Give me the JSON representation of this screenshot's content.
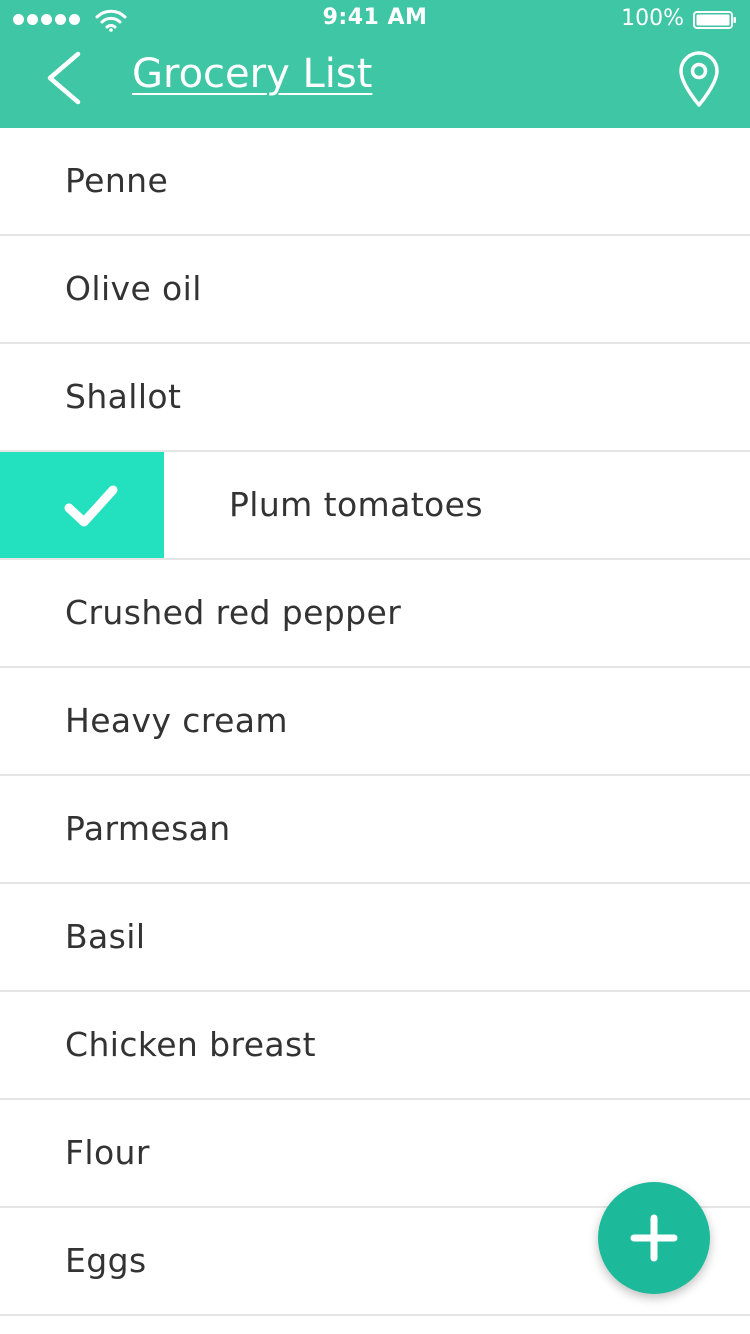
{
  "status_bar": {
    "time": "9:41 AM",
    "battery_percent": "100%",
    "signal_bars": 5,
    "icons": [
      "signal-dots-icon",
      "wifi-icon",
      "battery-icon"
    ]
  },
  "header": {
    "title": "Grocery List",
    "back_icon": "chevron-left-icon",
    "location_icon": "map-pin-icon",
    "background_color": "#3fc6a5"
  },
  "items": [
    {
      "label": "Penne",
      "swiped": false
    },
    {
      "label": "Olive oil",
      "swiped": false
    },
    {
      "label": "Shallot",
      "swiped": false
    },
    {
      "label": "Plum tomatoes",
      "swiped": true
    },
    {
      "label": "Crushed red pepper",
      "swiped": false
    },
    {
      "label": "Heavy cream",
      "swiped": false
    },
    {
      "label": "Parmesan",
      "swiped": false
    },
    {
      "label": "Basil",
      "swiped": false
    },
    {
      "label": "Chicken breast",
      "swiped": false
    },
    {
      "label": "Flour",
      "swiped": false
    },
    {
      "label": "Eggs",
      "swiped": false
    }
  ],
  "swipe_action": {
    "icon": "checkmark-icon",
    "color": "#23e1be"
  },
  "fab": {
    "icon": "plus-icon",
    "color": "#1cb99a"
  }
}
